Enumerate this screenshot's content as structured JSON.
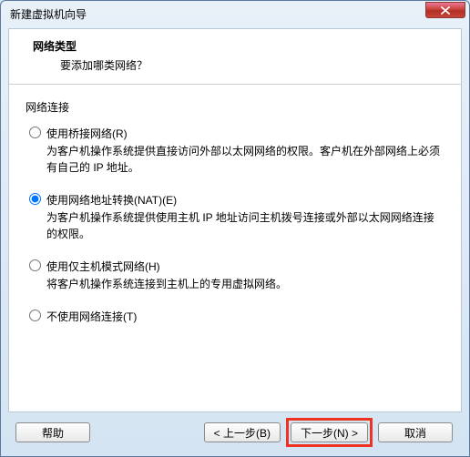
{
  "window": {
    "title": "新建虚拟机向导"
  },
  "header": {
    "title": "网络类型",
    "subtitle": "要添加哪类网络？"
  },
  "section_label": "网络连接",
  "options": [
    {
      "label": "使用桥接网络(R)",
      "desc": "为客户机操作系统提供直接访问外部以太网网络的权限。客户机在外部网络上必须有自己的 IP 地址。"
    },
    {
      "label": "使用网络地址转换(NAT)(E)",
      "desc": "为客户机操作系统提供使用主机 IP 地址访问主机拨号连接或外部以太网网络连接的权限。"
    },
    {
      "label": "使用仅主机模式网络(H)",
      "desc": "将客户机操作系统连接到主机上的专用虚拟网络。"
    },
    {
      "label": "不使用网络连接(T)",
      "desc": ""
    }
  ],
  "selected_index": 1,
  "buttons": {
    "help": "帮助",
    "back": "< 上一步(B)",
    "next": "下一步(N) >",
    "cancel": "取消"
  }
}
